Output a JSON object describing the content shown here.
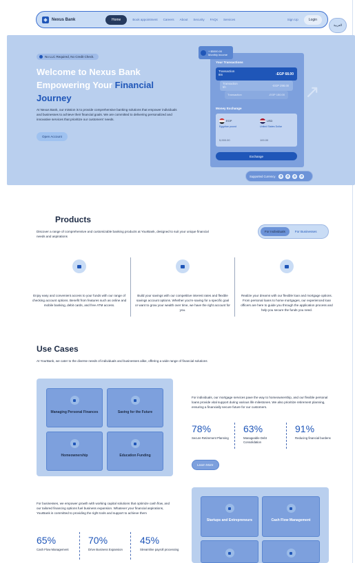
{
  "nav": {
    "brand": "Nexus Bank",
    "home": "Home",
    "links": [
      "Book appointment",
      "Careers",
      "About",
      "Security",
      "FAQs",
      "Services"
    ],
    "signup": "Sign Up",
    "login": "Login",
    "language": "العربية"
  },
  "hero": {
    "badge": "No LLC Required, No Credit Check.",
    "title_line1": "Welcome to Nexus Bank",
    "title_line2a": "Empowering Your ",
    "title_line2b": "Financial",
    "title_line3": "Journey",
    "description": "At Nexus Bank, our mission is to provide comprehensive banking solutions that empower individuals and businesses to achieve their financial goals. We are committed to delivering personalized and innovative services that prioritize our customers' needs.",
    "cta": "Open Account"
  },
  "phone": {
    "balance_value": "+ $5000.00",
    "balance_label": "Monthly income",
    "transactions_heading": "Your Transactions",
    "transactions": [
      {
        "name": "Transaction",
        "sub": "8m",
        "amount": "-EGP 68.00"
      },
      {
        "name": "Transaction",
        "sub": "5h",
        "amount": "-EGP 298.00"
      },
      {
        "name": "Transaction",
        "sub": "1d",
        "amount": "-EGP 150.00"
      }
    ],
    "exchange_heading": "Money Exchange",
    "from_code": "EGP",
    "from_name": "Egyptian pound",
    "from_value": "5,000.00",
    "to_code": "USD",
    "to_name": "United States Dollar",
    "to_value": "100.00",
    "exchange_button": "Exchange",
    "supported_label": "Supported Currency",
    "currency_symbols": [
      "$",
      "€",
      "£",
      "¥"
    ]
  },
  "products": {
    "title": "Products",
    "description": "Discover a range of comprehensive and customizable banking products at YourBank, designed to suit your unique financial needs and aspirations",
    "toggle_on": "For Individuals",
    "toggle_off": "For Businesses",
    "cards": [
      {
        "icon": "briefcase-icon",
        "text": "Enjoy easy and convenient access to your funds with our range of checking account options. Benefit from features such as online and mobile banking, debit cards, and free ATM access."
      },
      {
        "icon": "archive-icon",
        "text": "Build your savings with our competitive interest rates and flexible savings account options. Whether you're saving for a specific goal or want to grow your wealth over time, we have the right account for you."
      },
      {
        "icon": "loan-icon",
        "text": "Realize your dreams with our flexible loan and mortgage options. From personal loans to home mortgages, our experienced loan officers are here to guide you through the application process and help you secure the funds you need."
      }
    ]
  },
  "use_cases": {
    "title": "Use Cases",
    "description": "At YourBank, we cater to the diverse needs of individuals and businesses alike, offering a wide range of financial solutions",
    "individual_cards": [
      "Managing Personal Finances",
      "Saving for the Future",
      "Homeownership",
      "Education Funding"
    ],
    "individual_text": "For individuals, our mortgage services pave the way to homeownership, and our flexible personal loans provide vital support during various life milestones. We also prioritize retirement planning, ensuring a financially secure future for our customers.",
    "individual_stats": [
      {
        "value": "78%",
        "label": "Secure Retirement Planning"
      },
      {
        "value": "63%",
        "label": "Manageable Debt Consolidation"
      },
      {
        "value": "91%",
        "label": "Reducing financial burdens"
      }
    ],
    "learn_more": "Learn More",
    "business_text": "For businesses, we empower growth with working capital solutions that optimize cash flow, and our tailored financing options fuel business expansion. Whatever your financial aspirations, YourBank is committed to providing the right tools and support to achieve them",
    "business_stats": [
      {
        "value": "65%",
        "label": "Cash Flow Management"
      },
      {
        "value": "70%",
        "label": "Drive Business Expansion"
      },
      {
        "value": "45%",
        "label": "Streamline payroll processing"
      }
    ],
    "business_cards": [
      "Startups and Entrepreneurs",
      "Cash Flow Management",
      "",
      ""
    ]
  }
}
